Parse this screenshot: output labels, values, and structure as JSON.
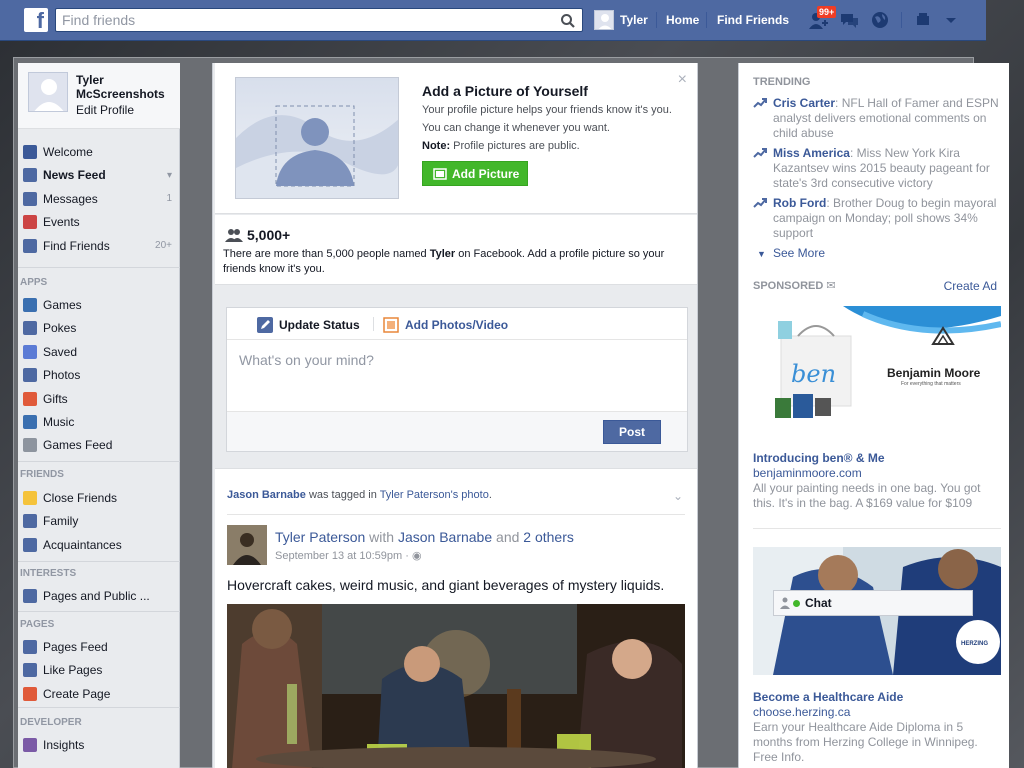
{
  "topbar": {
    "logo": "f",
    "search_placeholder": "Find friends",
    "user_name": "Tyler",
    "home_label": "Home",
    "find_friends_label": "Find Friends",
    "friend_requests_badge": "99+"
  },
  "profile": {
    "name": "Tyler McScreenshots",
    "edit_label": "Edit Profile"
  },
  "nav": {
    "main": [
      {
        "label": "Welcome",
        "icon": "facebook-icon",
        "color": "#3b5998"
      },
      {
        "label": "News Feed",
        "icon": "news-feed-icon",
        "color": "#4e69a2",
        "bold": true
      },
      {
        "label": "Messages",
        "icon": "messages-icon",
        "color": "#4e69a2",
        "count": "1"
      },
      {
        "label": "Events",
        "icon": "events-icon",
        "color": "#c44",
        "count": ""
      },
      {
        "label": "Find Friends",
        "icon": "find-friends-icon",
        "color": "#4e69a2",
        "count": "20+"
      }
    ],
    "apps_heading": "APPS",
    "apps": [
      {
        "label": "Games",
        "icon": "games-icon",
        "color": "#3a6fb0"
      },
      {
        "label": "Pokes",
        "icon": "pokes-icon",
        "color": "#4e69a2"
      },
      {
        "label": "Saved",
        "icon": "saved-icon",
        "color": "#5b7bd5"
      },
      {
        "label": "Photos",
        "icon": "photos-icon",
        "color": "#4e69a2"
      },
      {
        "label": "Gifts",
        "icon": "gifts-icon",
        "color": "#e05a3a"
      },
      {
        "label": "Music",
        "icon": "music-icon",
        "color": "#3a6fb0"
      },
      {
        "label": "Games Feed",
        "icon": "games-feed-icon",
        "color": "#8d949e"
      }
    ],
    "friends_heading": "FRIENDS",
    "friends": [
      {
        "label": "Close Friends",
        "icon": "star-icon",
        "color": "#f5c33b"
      },
      {
        "label": "Family",
        "icon": "family-icon",
        "color": "#4e69a2"
      },
      {
        "label": "Acquaintances",
        "icon": "acquaintances-icon",
        "color": "#4e69a2"
      }
    ],
    "interests_heading": "INTERESTS",
    "interests": [
      {
        "label": "Pages and Public ...",
        "icon": "pages-public-icon",
        "color": "#4e69a2"
      }
    ],
    "pages_heading": "PAGES",
    "pages": [
      {
        "label": "Pages Feed",
        "icon": "pages-feed-icon",
        "color": "#4e69a2"
      },
      {
        "label": "Like Pages",
        "icon": "like-icon",
        "color": "#4e69a2"
      },
      {
        "label": "Create Page",
        "icon": "create-page-icon",
        "color": "#e05a3a"
      }
    ],
    "developer_heading": "DEVELOPER",
    "developer": [
      {
        "label": "Insights",
        "icon": "insights-icon",
        "color": "#7b5aa6"
      }
    ]
  },
  "add_picture": {
    "title": "Add a Picture of Yourself",
    "desc": "Your profile picture helps your friends know it's you. You can change it whenever you want.",
    "note_label": "Note:",
    "note_text": "Profile pictures are public.",
    "button": "Add Picture",
    "close": "×"
  },
  "name_count": {
    "count": "5,000+",
    "text_a": "There are more than 5,000 people named",
    "text_name": "Tyler",
    "text_b": "on Facebook. Add a profile picture so your friends know it's you."
  },
  "composer": {
    "tab_status": "Update Status",
    "tab_photos": "Add Photos/Video",
    "placeholder": "What's on your mind?",
    "post_button": "Post"
  },
  "story": {
    "tag_actor": "Jason Barnabe",
    "tag_verb": "was tagged in",
    "tag_owner": "Tyler Paterson's",
    "tag_object": "photo",
    "tag_end": ".",
    "author": "Tyler Paterson",
    "with_word": "with",
    "with_name": "Jason Barnabe",
    "and_word": "and",
    "others": "2 others",
    "timestamp": "September 13 at 10:59pm · ",
    "message": "Hovercraft cakes, weird music, and giant beverages of mystery liquids."
  },
  "trending": {
    "heading": "TRENDING",
    "items": [
      {
        "topic": "Cris Carter",
        "text": ": NFL Hall of Famer and ESPN analyst delivers emotional comments on child abuse"
      },
      {
        "topic": "Miss America",
        "text": ": Miss New York Kira Kazantsev wins 2015 beauty pageant for state's 3rd consecutive victory"
      },
      {
        "topic": "Rob Ford",
        "text": ": Brother Doug to begin mayoral campaign on Monday; poll shows 34% support"
      }
    ],
    "see_more": "See More"
  },
  "sponsored": {
    "heading": "SPONSORED",
    "create_ad": "Create Ad",
    "ad1": {
      "brand_logo": "Benjamin Moore",
      "brand_tagline": "For everything that matters",
      "bag_text": "ben",
      "title": "Introducing ben® & Me",
      "url": "benjaminmoore.com",
      "desc": "All your painting needs in one bag. You got this. It's in the bag. A $169 value for $109"
    },
    "ad2": {
      "logo_text": "HERZING",
      "title": "Become a Healthcare Aide",
      "url": "choose.herzing.ca",
      "desc": "Earn your Healthcare Aide Diploma in 5 months from Herzing College in Winnipeg. Free Info."
    }
  },
  "chat": {
    "label": "Chat"
  }
}
